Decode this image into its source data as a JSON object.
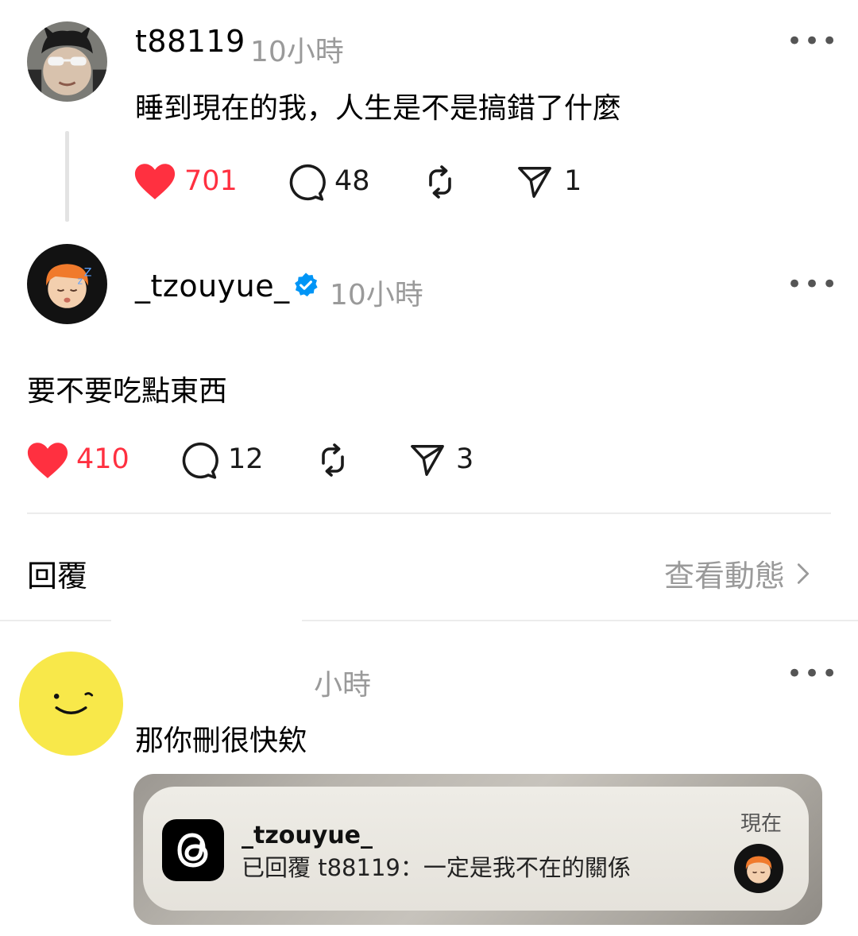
{
  "post1": {
    "username": "t88119",
    "time": "10小時",
    "text": "睡到現在的我，人生是不是搞錯了什麼",
    "likes": "701",
    "comments": "48",
    "shares": "1",
    "more": "•••"
  },
  "post2": {
    "username": "_tzouyue_",
    "time": "10小時",
    "text": "要不要吃點東西",
    "likes": "410",
    "comments": "12",
    "shares": "3",
    "more": "•••"
  },
  "replies_header": {
    "title": "回覆",
    "view_activity": "查看動態 "
  },
  "reply1": {
    "time": "小時",
    "text": "那你刪很快欸",
    "more": "•••"
  },
  "notification": {
    "app_icon": "threads-icon",
    "title": "_tzouyue_",
    "body": "已回覆 t88119：一定是我不在的關係",
    "time": "現在"
  },
  "colors": {
    "like_red": "#ff3040",
    "verified_blue": "#0095f6",
    "muted_gray": "#9a9a9a",
    "avatar_yellow": "#f8e84a"
  }
}
